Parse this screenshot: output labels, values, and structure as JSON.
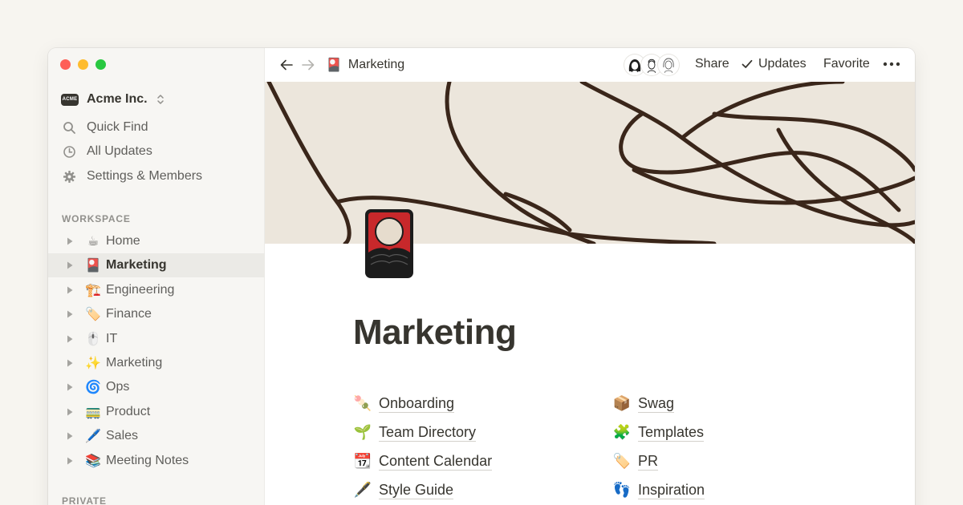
{
  "sidebar": {
    "workspace": {
      "logo_text": "ACME",
      "name": "Acme Inc."
    },
    "links": [
      {
        "label": "Quick Find",
        "icon": "search-icon"
      },
      {
        "label": "All Updates",
        "icon": "clock-icon"
      },
      {
        "label": "Settings & Members",
        "icon": "gear-icon"
      }
    ],
    "workspace_label": "WORKSPACE",
    "private_label": "PRIVATE",
    "pages": [
      {
        "emoji": "☕",
        "label": "Home"
      },
      {
        "emoji": "🎴",
        "label": "Marketing",
        "active": true
      },
      {
        "emoji": "🏗️",
        "label": "Engineering"
      },
      {
        "emoji": "🏷️",
        "label": "Finance"
      },
      {
        "emoji": "🖱️",
        "label": "IT"
      },
      {
        "emoji": "✨",
        "label": "Marketing"
      },
      {
        "emoji": "🌀",
        "label": "Ops"
      },
      {
        "emoji": "🚃",
        "label": "Product"
      },
      {
        "emoji": "🖊️",
        "label": "Sales"
      },
      {
        "emoji": "📚",
        "label": "Meeting Notes"
      }
    ]
  },
  "topbar": {
    "breadcrumb": {
      "emoji": "🎴",
      "label": "Marketing"
    },
    "share_label": "Share",
    "updates_label": "Updates",
    "favorite_label": "Favorite",
    "more_label": "•••"
  },
  "page": {
    "title": "Marketing",
    "links_left": [
      {
        "emoji": "🍡",
        "label": "Onboarding"
      },
      {
        "emoji": "🌱",
        "label": "Team Directory"
      },
      {
        "emoji": "📆",
        "label": "Content Calendar"
      },
      {
        "emoji": "🖋️",
        "label": "Style Guide"
      }
    ],
    "links_right": [
      {
        "emoji": "📦",
        "label": "Swag"
      },
      {
        "emoji": "🧩",
        "label": "Templates"
      },
      {
        "emoji": "🏷️",
        "label": "PR"
      },
      {
        "emoji": "👣",
        "label": "Inspiration"
      }
    ]
  },
  "colors": {
    "page_background": "#f7f5f0",
    "sidebar_background": "#f7f6f3",
    "active_row": "#ebeae6",
    "text": "#37352f",
    "muted_text": "#5f5e5b",
    "cover_background": "#ece6dc",
    "cover_lines": "#3a261a",
    "icon_red": "#c8282b"
  }
}
